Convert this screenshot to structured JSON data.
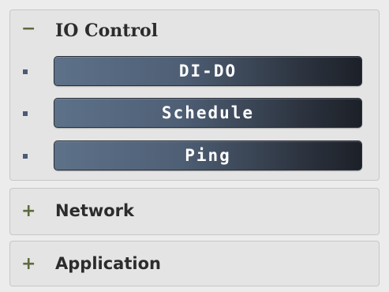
{
  "sidebar": {
    "io_control": {
      "toggle": "−",
      "title": "IO Control",
      "items": [
        {
          "label": "DI-DO"
        },
        {
          "label": "Schedule"
        },
        {
          "label": "Ping"
        }
      ]
    },
    "network": {
      "toggle": "+",
      "title": "Network"
    },
    "application": {
      "toggle": "+",
      "title": "Application"
    }
  },
  "colors": {
    "toggle": "#5e6a3e",
    "bullet": "#4d5a78",
    "button_light": "#5d7189",
    "button_dark": "#1c2028",
    "panel_bg": "#e4e4e4"
  },
  "icons": {
    "collapse": "minus-icon",
    "expand": "plus-icon",
    "bullet": "square-bullet-icon"
  }
}
